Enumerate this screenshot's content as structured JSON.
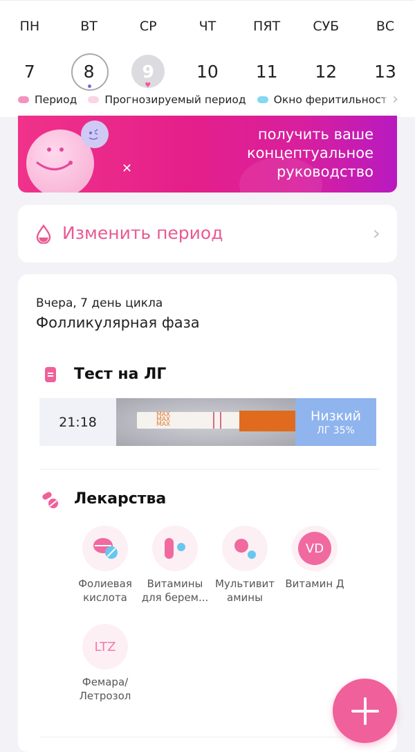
{
  "calendar": {
    "weekdays": [
      "ПН",
      "ВТ",
      "СР",
      "ЧТ",
      "ПЯТ",
      "СУБ",
      "ВС"
    ],
    "dates": [
      "7",
      "8",
      "9",
      "10",
      "11",
      "12",
      "13"
    ],
    "selected_date": "8",
    "legend": [
      {
        "label": "Период",
        "color": "#f393bd"
      },
      {
        "label": "Прогнозируемый период",
        "color": "#fbd4e6"
      },
      {
        "label": "Окно феритильности",
        "color": "#84d8f0"
      }
    ]
  },
  "banner": {
    "text_line1": "получить ваше",
    "text_line2": "концептуальное",
    "text_line3": "руководство"
  },
  "edit_period": {
    "label": "Изменить период",
    "icon": "drop-icon"
  },
  "cycle": {
    "day_text": "Вчера, 7 день цикла",
    "phase": "Фолликулярная фаза"
  },
  "lh_test": {
    "title": "Тест на ЛГ",
    "time": "21:18",
    "result": "Низкий",
    "result_detail": "ЛГ 35%",
    "strip_text": [
      "MAX",
      "MAX",
      "MAX"
    ]
  },
  "medications": {
    "title": "Лекарства",
    "items": [
      {
        "line1": "Фолиевая",
        "line2": "кислота",
        "icon": "pills-icon"
      },
      {
        "line1": "Витамины",
        "line2": "для берем...",
        "icon": "capsule-icon"
      },
      {
        "line1": "Мультивит",
        "line2": "амины",
        "icon": "dots-icon"
      },
      {
        "line1": "Витамин Д",
        "line2": "",
        "icon": "vd-icon",
        "badge": "VD"
      },
      {
        "line1": "Фемара/",
        "line2": "Летрозол",
        "icon": "ltz-icon",
        "badge": "LTZ"
      }
    ]
  },
  "colors": {
    "accent": "#f0609a",
    "banner_start": "#f0328a",
    "banner_end": "#b81ac0",
    "lh_low": "#8fb4ee"
  }
}
